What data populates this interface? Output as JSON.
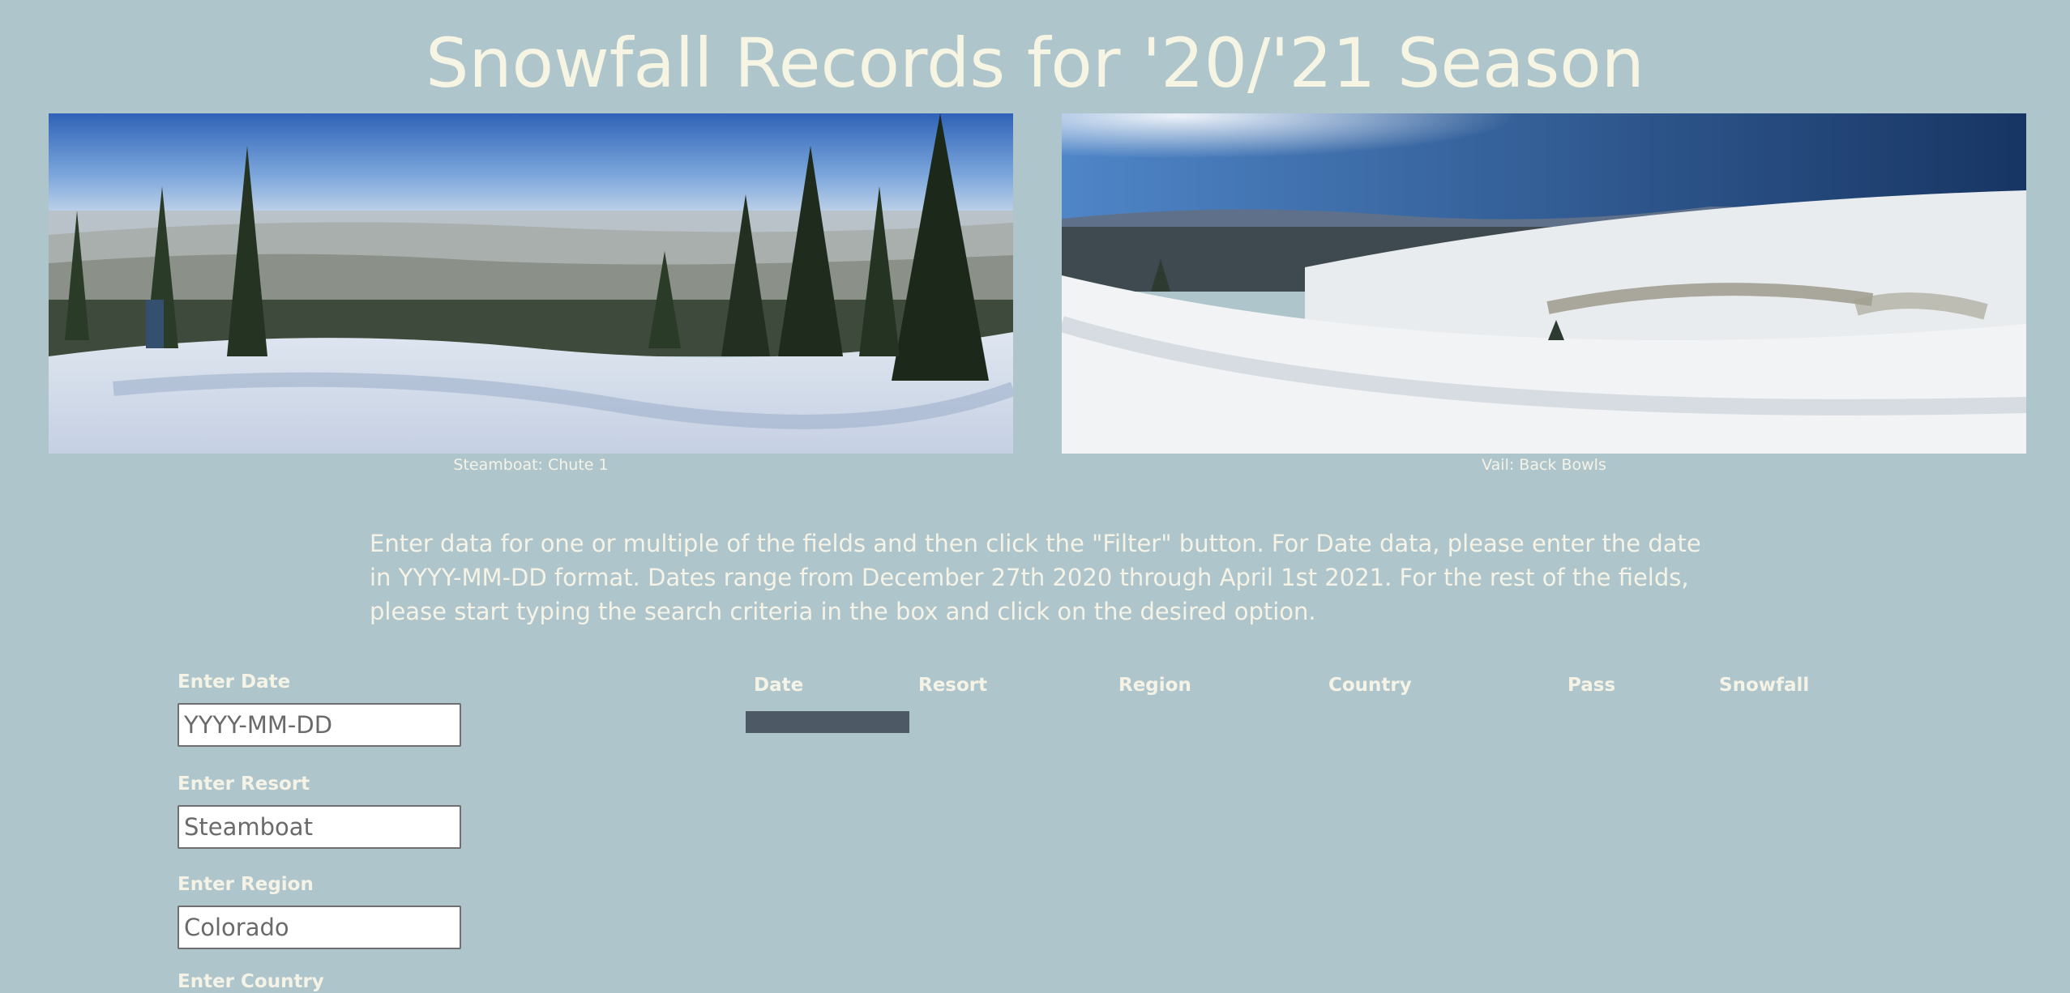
{
  "page": {
    "title": "Snowfall Records for '20/'21 Season"
  },
  "photos": [
    {
      "caption": "Steamboat: Chute 1"
    },
    {
      "caption": "Vail: Back Bowls"
    }
  ],
  "instructions": "Enter data for one or multiple of the fields and then click the \"Filter\" button. For Date data, please enter the date in YYYY-MM-DD format. Dates range from December 27th 2020 through April 1st 2021. For the rest of the fields, please start typing the search criteria in the box and click on the desired option.",
  "form": {
    "date": {
      "label": "Enter Date",
      "placeholder": "YYYY-MM-DD"
    },
    "resort": {
      "label": "Enter Resort",
      "placeholder": "Steamboat"
    },
    "region": {
      "label": "Enter Region",
      "placeholder": "Colorado"
    },
    "country": {
      "label": "Enter Country"
    }
  },
  "table": {
    "headers": [
      "Date",
      "Resort",
      "Region",
      "Country",
      "Pass",
      "Snowfall"
    ]
  },
  "colors": {
    "background": "#afc5cc",
    "title": "#f6f4e3",
    "filter_bar": "#4d5a66"
  }
}
